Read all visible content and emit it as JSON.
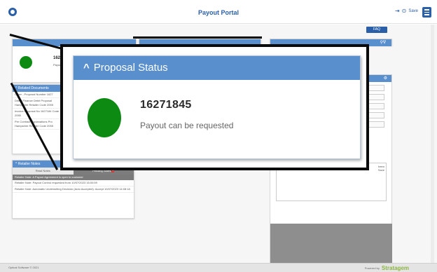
{
  "header": {
    "app_title": "Payout Portal",
    "save_label": "Save",
    "logo_icon": "globe-logo-icon",
    "logout_icon": "logout-icon",
    "help_icon": "help-icon",
    "menu_icon": "hamburger-menu-icon"
  },
  "toolbar": {
    "faq_label": "FAQ"
  },
  "proposal_status": {
    "title": "Proposal Status",
    "proposal_number": "16271845",
    "status_message": "Payout can be requested",
    "status_color": "#0d8a12",
    "mini_number": "16271845",
    "mini_message": "Payout can b"
  },
  "related_documents": {
    "title": "Related Documents",
    "items": [
      "Other - Proposal Number 1627",
      "Direct Finance Debit Proposal Hampshire Retailer Code 2055",
      "Invoice Proposal No 1627184 Code 2055",
      "Pre Contract Explanations Pro Hampshire Retailer Code 2055"
    ]
  },
  "retailer_notes": {
    "title": "Retailer Notes",
    "tabs": [
      {
        "label": "Read Notes",
        "active": false
      },
      {
        "label": "Pending Notes",
        "active": true,
        "badge": "2"
      }
    ],
    "band_note": "Retailer Note: A Payout Agreement is open to customer",
    "notes": [
      "Retailer Note: Payout Control requested from 10/07/2023 16:00:59",
      "Retailer Note: Automatic Underwriting Decision (Auto Accepted): Accept 10/07/2023 14:08:18"
    ]
  },
  "right_panel": {
    "note_text": "been\nSave"
  },
  "footer": {
    "copyright": "Optical Software © 2021",
    "powered_by": "Powered by",
    "brand": "Stratagem"
  },
  "colors": {
    "accent": "#2b5fa8",
    "panel_header": "#5a8fce",
    "status_green": "#0d8a12",
    "badge_red": "#d33333"
  }
}
